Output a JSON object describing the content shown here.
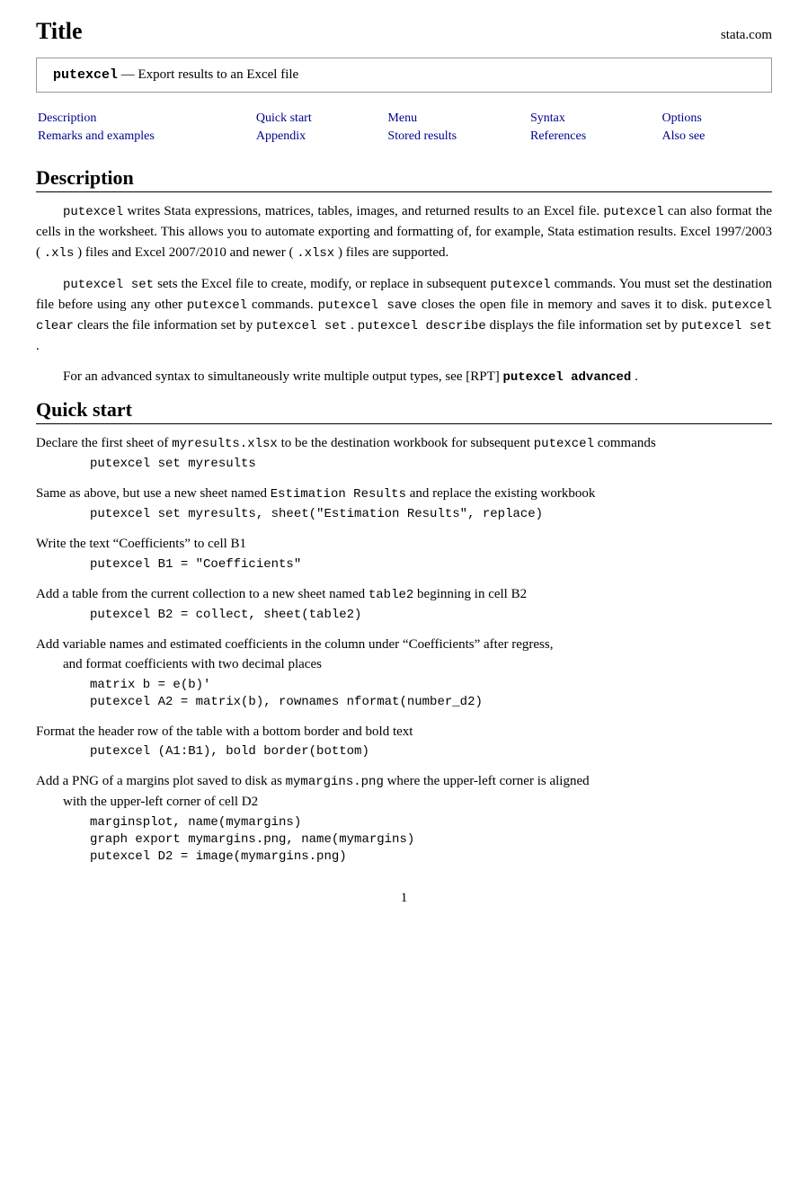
{
  "title": "Title",
  "brand": "stata.com",
  "command_box": {
    "cmd": "putexcel",
    "dash": "—",
    "description": "Export results to an Excel file"
  },
  "nav": {
    "col1_row1": "Description",
    "col1_row2": "Remarks and examples",
    "col2_row1": "Quick start",
    "col2_row2": "Appendix",
    "col3_row1": "Menu",
    "col3_row2": "Stored results",
    "col4_row1": "Syntax",
    "col4_row2": "References",
    "col5_row1": "Options",
    "col5_row2": "Also see"
  },
  "description": {
    "heading": "Description",
    "para1_parts": [
      {
        "type": "mono",
        "text": "putexcel"
      },
      {
        "type": "text",
        "text": " writes Stata expressions, matrices, tables, images, and returned results to an Excel file. "
      },
      {
        "type": "mono",
        "text": "putexcel"
      },
      {
        "type": "text",
        "text": " can also format the cells in the worksheet. This allows you to automate exporting and formatting of, for example, Stata estimation results. Excel 1997/2003 ("
      },
      {
        "type": "mono",
        "text": ".xls"
      },
      {
        "type": "text",
        "text": ") files and Excel 2007/2010 and newer ("
      },
      {
        "type": "mono",
        "text": ".xlsx"
      },
      {
        "type": "text",
        "text": ") files are supported."
      }
    ],
    "para2_parts": [
      {
        "type": "mono",
        "text": "putexcel set"
      },
      {
        "type": "text",
        "text": " sets the Excel file to create, modify, or replace in subsequent "
      },
      {
        "type": "mono",
        "text": "putexcel"
      },
      {
        "type": "text",
        "text": " commands. You must set the destination file before using any other "
      },
      {
        "type": "mono",
        "text": "putexcel"
      },
      {
        "type": "text",
        "text": " commands. "
      },
      {
        "type": "mono",
        "text": "putexcel save"
      },
      {
        "type": "text",
        "text": " closes the open file in memory and saves it to disk. "
      },
      {
        "type": "mono",
        "text": "putexcel clear"
      },
      {
        "type": "text",
        "text": " clears the file information set by "
      },
      {
        "type": "mono",
        "text": "putexcel set"
      },
      {
        "type": "text",
        "text": ". "
      },
      {
        "type": "mono",
        "text": "putexcel describe"
      },
      {
        "type": "text",
        "text": " displays the file information set by "
      },
      {
        "type": "mono",
        "text": "putexcel set"
      },
      {
        "type": "text",
        "text": "."
      }
    ],
    "para3_parts": [
      {
        "type": "text",
        "text": "For an advanced syntax to simultaneously write multiple output types, see [RPT] "
      },
      {
        "type": "boldmono",
        "text": "putexcel advanced"
      },
      {
        "type": "text",
        "text": "."
      }
    ]
  },
  "quickstart": {
    "heading": "Quick start",
    "items": [
      {
        "desc": "Declare the first sheet of myresults.xlsx to be the destination workbook for subsequent putexcel commands",
        "desc_mono_positions": [
          {
            "word": "myresults.xlsx",
            "type": "mono"
          },
          {
            "word": "putexcel",
            "type": "mono"
          }
        ],
        "code_lines": [
          "putexcel set myresults"
        ]
      },
      {
        "desc": "Same as above, but use a new sheet named Estimation Results and replace the existing workbook",
        "desc_mono_positions": [
          {
            "word": "Estimation Results",
            "type": "mono"
          }
        ],
        "code_lines": [
          "putexcel set myresults, sheet(\"Estimation Results\", replace)"
        ]
      },
      {
        "desc": "Write the text “Coefficients” to cell B1",
        "code_lines": [
          "putexcel B1 = \"Coefficients\""
        ]
      },
      {
        "desc": "Add a table from the current collection to a new sheet named table2 beginning in cell B2",
        "desc_mono_positions": [
          {
            "word": "table2",
            "type": "mono"
          }
        ],
        "code_lines": [
          "putexcel B2 = collect, sheet(table2)"
        ]
      },
      {
        "desc": "Add variable names and estimated coefficients in the column under “Coefficients” after regress, and format coefficients with two decimal places",
        "code_lines": [
          "matrix b = e(b)'",
          "putexcel A2 = matrix(b), rownames nformat(number_d2)"
        ]
      },
      {
        "desc": "Format the header row of the table with a bottom border and bold text",
        "code_lines": [
          "putexcel (A1:B1), bold border(bottom)"
        ]
      },
      {
        "desc": "Add a PNG of a margins plot saved to disk as mymargins.png where the upper-left corner is aligned with the upper-left corner of cell D2",
        "desc_mono_positions": [
          {
            "word": "mymargins.png",
            "type": "mono"
          },
          {
            "word": "D2",
            "type": "mono"
          }
        ],
        "code_lines": [
          "marginsplot, name(mymargins)",
          "graph export mymargins.png, name(mymargins)",
          "putexcel D2 = image(mymargins.png)"
        ]
      }
    ]
  },
  "page_number": "1"
}
